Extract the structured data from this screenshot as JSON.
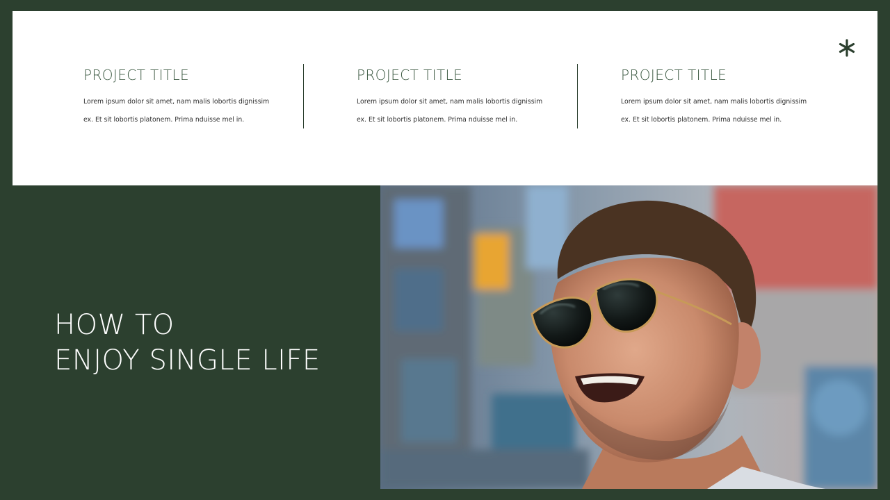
{
  "projects": [
    {
      "title": "PROJECT TITLE",
      "line1": "Lorem ipsum dolor sit amet, nam malis lobortis dignissim",
      "line2": "ex. Et sit lobortis platonem. Prima nduisse mel in."
    },
    {
      "title": "PROJECT TITLE",
      "line1": "Lorem ipsum dolor sit amet, nam malis lobortis dignissim",
      "line2": "ex. Et sit lobortis platonem. Prima nduisse mel in."
    },
    {
      "title": "PROJECT TITLE",
      "line1": "Lorem ipsum dolor sit amet, nam malis lobortis dignissim",
      "line2": "ex. Et sit lobortis platonem. Prima nduisse mel in."
    }
  ],
  "headline": {
    "line1": "HOW TO",
    "line2": "ENJOY SINGLE LIFE"
  },
  "decor": {
    "icon": "asterisk-icon",
    "photo": "smiling-man-in-sunglasses-photo"
  },
  "colors": {
    "background": "#2c402f",
    "panel": "#ffffff",
    "accent": "#3d5a43"
  }
}
